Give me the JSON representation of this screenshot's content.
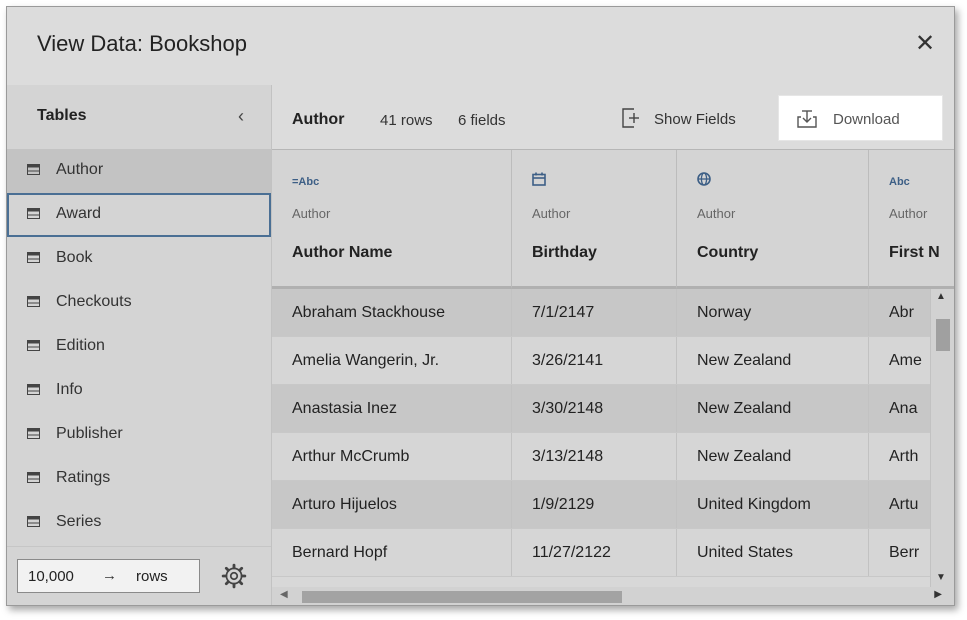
{
  "dialog": {
    "title": "View Data: Bookshop",
    "close_label": "✕"
  },
  "sidebar": {
    "title": "Tables",
    "collapse_label": "‹",
    "items": [
      {
        "label": "Author",
        "icon": "table-icon",
        "state": "selected"
      },
      {
        "label": "Award",
        "icon": "table-icon",
        "state": "focused"
      },
      {
        "label": "Book",
        "icon": "table-icon"
      },
      {
        "label": "Checkouts",
        "icon": "table-icon"
      },
      {
        "label": "Edition",
        "icon": "table-icon"
      },
      {
        "label": "Info",
        "icon": "table-icon"
      },
      {
        "label": "Publisher",
        "icon": "table-icon"
      },
      {
        "label": "Ratings",
        "icon": "table-icon"
      },
      {
        "label": "Series",
        "icon": "table-icon"
      }
    ],
    "footer": {
      "rows_value": "10,000",
      "arrow": "→",
      "rows_label": "rows",
      "settings_icon": "gear-icon"
    }
  },
  "toolbar": {
    "table_name": "Author",
    "row_count": "41 rows",
    "field_count": "6 fields",
    "show_fields_label": "Show Fields",
    "download_label": "Download"
  },
  "grid": {
    "columns": [
      {
        "type_label": "=Abc",
        "type_icon": "calculated-string-icon",
        "source": "Author",
        "name": "Author Name"
      },
      {
        "type_label": "",
        "type_icon": "calendar-icon",
        "source": "Author",
        "name": "Birthday"
      },
      {
        "type_label": "",
        "type_icon": "globe-icon",
        "source": "Author",
        "name": "Country"
      },
      {
        "type_label": "Abc",
        "type_icon": "string-icon",
        "source": "Author",
        "name": "First N"
      }
    ],
    "rows": [
      [
        "Abraham Stackhouse",
        "7/1/2147",
        "Norway",
        "Abr"
      ],
      [
        "Amelia Wangerin, Jr.",
        "3/26/2141",
        "New Zealand",
        "Ame"
      ],
      [
        "Anastasia Inez",
        "3/30/2148",
        "New Zealand",
        "Ana"
      ],
      [
        "Arthur McCrumb",
        "3/13/2148",
        "New Zealand",
        "Arth"
      ],
      [
        "Arturo Hijuelos",
        "1/9/2129",
        "United Kingdom",
        "Artu"
      ],
      [
        "Bernard Hopf",
        "11/27/2122",
        "United States",
        "Berr"
      ]
    ]
  },
  "colors": {
    "focus_border": "#4a6f94",
    "type_icon": "#3d5f86"
  }
}
